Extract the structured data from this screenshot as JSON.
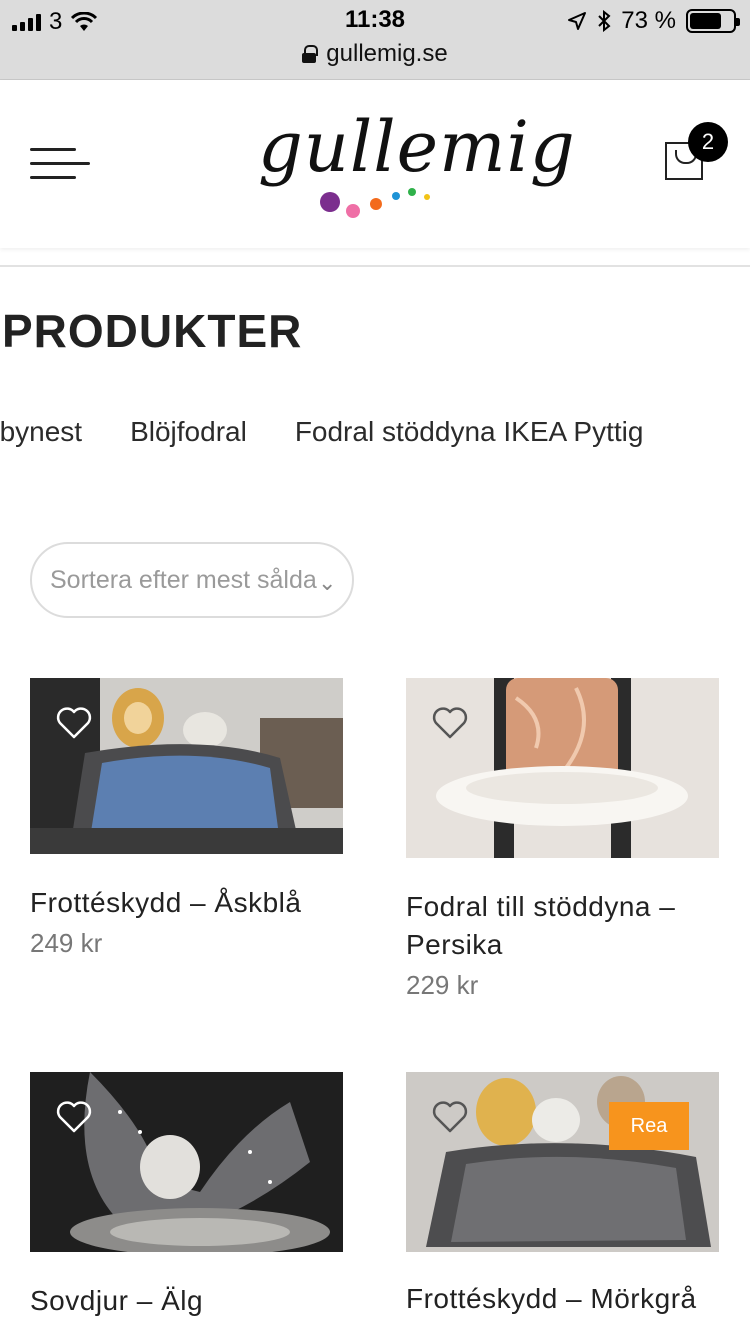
{
  "status_bar": {
    "carrier": "3",
    "time": "11:38",
    "battery": "73 %",
    "battery_level": 0.73,
    "url": "gullemig.se"
  },
  "header": {
    "logo_text": "gullemig",
    "cart_count": "2",
    "dot_colors": [
      "#7b2e8e",
      "#ef6fa6",
      "#f36b1c",
      "#1e93d6",
      "#2fb14a",
      "#f2c316"
    ]
  },
  "page": {
    "title": "PRODUKTER"
  },
  "categories": [
    "abynest",
    "Blöjfodral",
    "Fodral stöddyna IKEA Pyttig"
  ],
  "sort": {
    "label": "Sortera efter mest sålda"
  },
  "products": [
    {
      "name": "Frottéskydd – Åskblå",
      "price": "249 kr"
    },
    {
      "name": "Fodral till stöddyna – Persika",
      "price": "229 kr"
    },
    {
      "name": "Sovdjur – Älg",
      "price": ""
    },
    {
      "name": "Frottéskydd – Mörkgrå",
      "price": "",
      "badge": "Rea"
    }
  ],
  "colors": {
    "badge": "#f7941d",
    "text": "#222222",
    "price": "#777777"
  }
}
